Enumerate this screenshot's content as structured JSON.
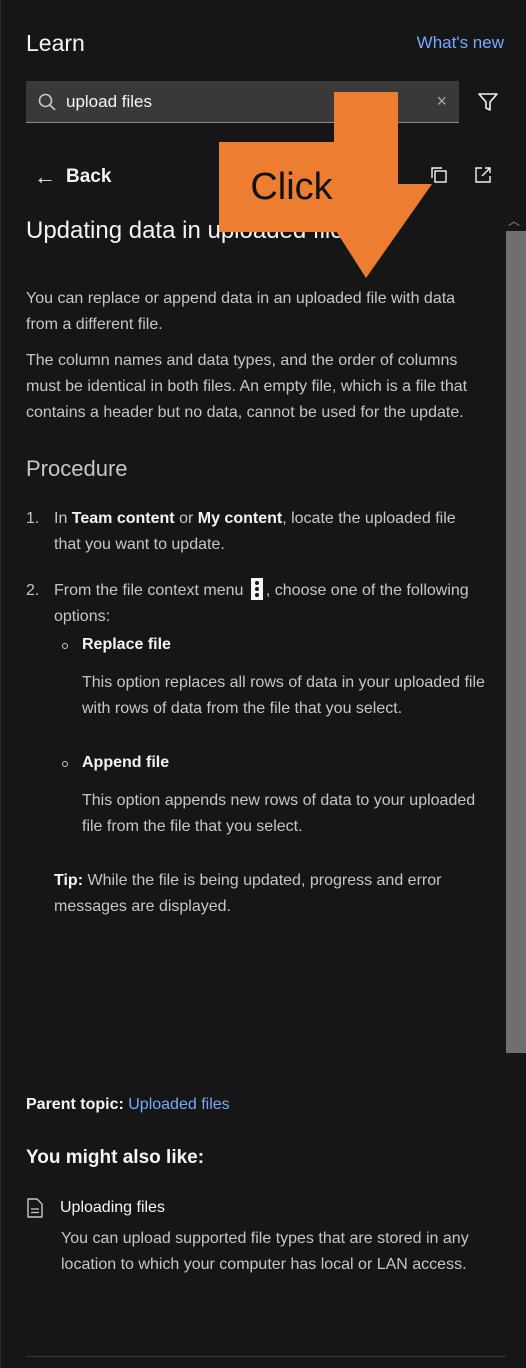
{
  "header": {
    "title": "Learn",
    "whats_new": "What's new"
  },
  "search": {
    "value": "upload files",
    "clear": "×"
  },
  "toolbar": {
    "back_label": "Back"
  },
  "article": {
    "title": "Updating data in uploaded files",
    "intro": "You can replace or append data in an uploaded file with data from a different file.",
    "note": "The column names and data types, and the order of columns must be identical in both files. An empty file, which is a file that contains a header but no data, cannot be used for the update.",
    "procedure_heading": "Procedure",
    "steps": [
      {
        "num": "1.",
        "pre": "In ",
        "b1": "Team content",
        "mid": " or ",
        "b2": "My content",
        "post": ", locate the uploaded file that you want to update."
      },
      {
        "num": "2.",
        "pre": "From the file context menu",
        "post": ", choose one of the following options:",
        "options": [
          {
            "title": "Replace file",
            "desc": "This option replaces all rows of data in your uploaded file with rows of data from the file that you select."
          },
          {
            "title": "Append file",
            "desc": "This option appends new rows of data to your uploaded file from the file that you select."
          }
        ]
      }
    ],
    "tip_label": "Tip:",
    "tip_text": " While the file is being updated, progress and error messages are displayed."
  },
  "parent_topic": {
    "label": "Parent topic:",
    "link": "Uploaded files"
  },
  "also_like": {
    "title": "You might also like:",
    "items": [
      {
        "title": "Uploading files",
        "desc": "You can upload supported file types that are stored in any location to which your computer has local or LAN access."
      }
    ]
  },
  "annotation": {
    "callout": "Click",
    "color": "#ed7d31"
  }
}
